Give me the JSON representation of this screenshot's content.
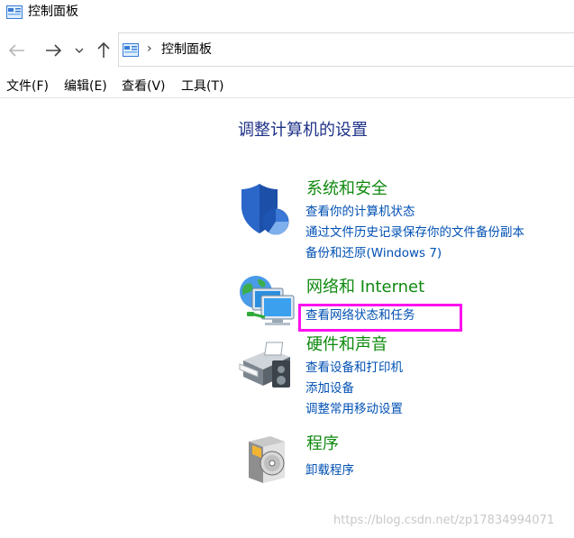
{
  "window": {
    "title": "控制面板"
  },
  "address_bar": {
    "path": "控制面板",
    "separator": "›"
  },
  "menu": [
    {
      "label": "文件(F)"
    },
    {
      "label": "编辑(E)"
    },
    {
      "label": "查看(V)"
    },
    {
      "label": "工具(T)"
    }
  ],
  "main": {
    "heading": "调整计算机的设置",
    "categories": [
      {
        "title": "系统和安全",
        "icon": "shield-icon",
        "links": [
          "查看你的计算机状态",
          "通过文件历史记录保存你的文件备份副本",
          "备份和还原(Windows 7)"
        ]
      },
      {
        "title": "网络和 Internet",
        "icon": "network-icon",
        "links": [
          "查看网络状态和任务"
        ]
      },
      {
        "title": "硬件和声音",
        "icon": "printer-icon",
        "links": [
          "查看设备和打印机",
          "添加设备",
          "调整常用移动设置"
        ]
      },
      {
        "title": "程序",
        "icon": "programs-icon",
        "links": [
          "卸载程序"
        ]
      }
    ]
  },
  "annotation": {
    "highlight_color": "#ff10f0"
  },
  "watermark": "https://blog.csdn.net/zp17834994071"
}
